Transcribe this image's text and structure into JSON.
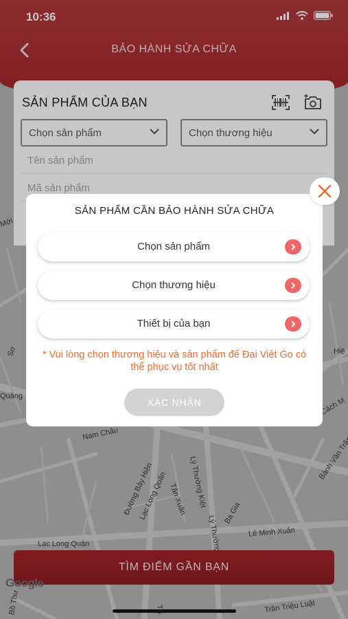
{
  "status_bar": {
    "time": "10:36"
  },
  "header": {
    "title": "BẢO HÀNH SỬA CHỮA"
  },
  "product_card": {
    "title": "SẢN PHẨM CỦA BẠN",
    "product_select": "Chọn sản phẩm",
    "brand_select": "Chọn thương hiệu",
    "product_name_placeholder": "Tên sản phẩm",
    "product_code_placeholder": "Mã sản phẩm"
  },
  "modal": {
    "title": "SẢN PHẨM CẦN BẢO HÀNH SỬA CHỮA",
    "options": [
      {
        "label": "Chọn sản phẩm"
      },
      {
        "label": "Chọn thương hiệu"
      },
      {
        "label": "Thiết bị của bạn"
      }
    ],
    "warning": "* Vui lòng chọn thương hiệu và sản phẩm để Đại Việt Go có thể phục vụ tốt nhất",
    "confirm_label": "XÁC NHẬN"
  },
  "find_button": {
    "label": "TÌM ĐIỂM GẦN BẠN"
  },
  "map": {
    "attribution": "Google",
    "streets": [
      "Quảng",
      "Nam Châu",
      "Đường Bảy Hiền",
      "Lạc Long Quân",
      "Tân Xuân",
      "Lý Thường Kiệt",
      "Lý Thường",
      "Ba Gia",
      "Lê Minh Xuân",
      "Lạc Long Quân",
      "Bành Văn Trân",
      "Cách M",
      "Trần Triệu Luật",
      "Hiệ",
      "Mới",
      "Sơ",
      "Bồ Thư",
      "Tạ"
    ]
  },
  "colors": {
    "primary": "#a4262d",
    "accent_orange": "#e96d2f",
    "arrow_red": "#ef6767"
  }
}
